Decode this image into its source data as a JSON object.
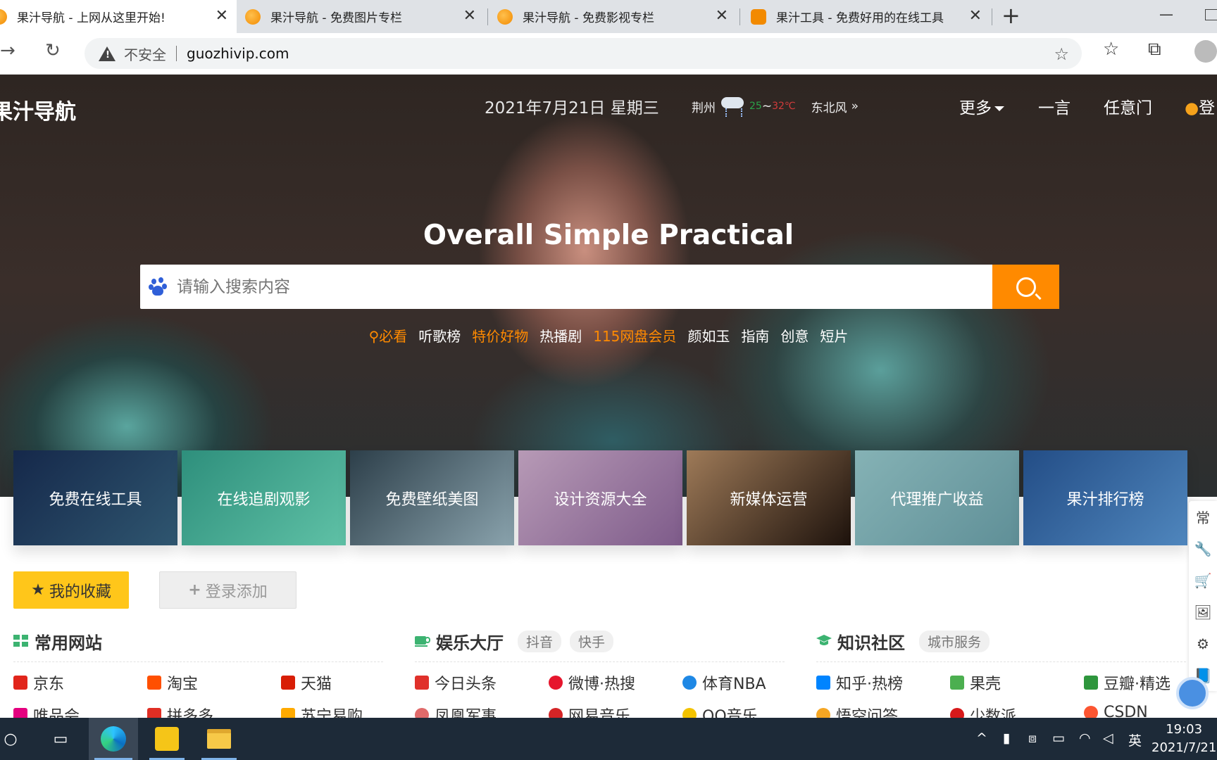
{
  "browser": {
    "tabs": [
      {
        "title": "果汁导航 - 上网从这里开始!",
        "active": true
      },
      {
        "title": "果汁导航 - 免费图片专栏",
        "active": false
      },
      {
        "title": "果汁导航 - 免费影视专栏",
        "active": false
      },
      {
        "title": "果汁工具 - 免费好用的在线工具",
        "active": false
      }
    ],
    "close_glyph": "✕",
    "new_tab_glyph": "+",
    "security_label": "不安全",
    "url": "guozhivip.com"
  },
  "header": {
    "brand": "果汁导航",
    "date": "2021年7月21日 星期三",
    "weather": {
      "city": "荆州",
      "low": "25",
      "sep": "~",
      "high": "32℃",
      "wind": "东北风",
      "more": "»"
    },
    "nav": {
      "more": "更多",
      "yiyan": "一言",
      "renyimen": "任意门",
      "login": "登"
    }
  },
  "hero": {
    "title": "Overall Simple Practical",
    "search_placeholder": "请输入搜索内容",
    "hot": [
      {
        "text": "必看",
        "highlight": true,
        "icon": "pin-icon"
      },
      {
        "text": "听歌榜",
        "highlight": false
      },
      {
        "text": "特价好物",
        "highlight": true
      },
      {
        "text": "热播剧",
        "highlight": false
      },
      {
        "text": "115网盘会员",
        "highlight": true
      },
      {
        "text": "颜如玉",
        "highlight": false
      },
      {
        "text": "指南",
        "highlight": false
      },
      {
        "text": "创意",
        "highlight": false
      },
      {
        "text": "短片",
        "highlight": false
      }
    ]
  },
  "cards": [
    {
      "label": "免费在线工具",
      "color": "#1f3b5e"
    },
    {
      "label": "在线追剧观影",
      "color": "#3fa58e"
    },
    {
      "label": "免费壁纸美图",
      "color": "#3f5560"
    },
    {
      "label": "设计资源大全",
      "color": "#8f6f95"
    },
    {
      "label": "新媒体运营",
      "color": "#6a4428"
    },
    {
      "label": "代理推广收益",
      "color": "#6c9fa8"
    },
    {
      "label": "果汁排行榜",
      "color": "#2d5c92"
    }
  ],
  "side_float": [
    "常",
    "🔧",
    "🛒",
    "🖼",
    "⚙",
    "📘"
  ],
  "favorites": {
    "my": "我的收藏",
    "add": "登录添加"
  },
  "sections": [
    {
      "title": "常用网站",
      "icon_color": "#3cb371",
      "chips": [],
      "links": [
        {
          "text": "京东",
          "color": "#e1251b"
        },
        {
          "text": "淘宝",
          "color": "#ff5000"
        },
        {
          "text": "天猫",
          "color": "#d81e06"
        },
        {
          "text": "唯品会",
          "color": "#e4007f"
        },
        {
          "text": "拼多多",
          "color": "#e02e24"
        },
        {
          "text": "苏宁易购",
          "color": "#ffaa00"
        }
      ]
    },
    {
      "title": "娱乐大厅",
      "icon_color": "#3cb371",
      "chips": [
        "抖音",
        "快手"
      ],
      "links": [
        {
          "text": "今日头条",
          "color": "#e0312b"
        },
        {
          "text": "微博·热搜",
          "color": "#e6162d"
        },
        {
          "text": "体育NBA",
          "color": "#1e88e5"
        },
        {
          "text": "凤凰军事",
          "color": "#e06a6a"
        },
        {
          "text": "网易音乐",
          "color": "#d42426"
        },
        {
          "text": "QQ音乐",
          "color": "#f3c300"
        }
      ]
    },
    {
      "title": "知识社区",
      "icon_color": "#3cb371",
      "chips": [
        "城市服务"
      ],
      "links": [
        {
          "text": "知乎·热榜",
          "color": "#0084ff"
        },
        {
          "text": "果壳",
          "color": "#4caf50"
        },
        {
          "text": "豆瓣·精选",
          "color": "#2e963d"
        },
        {
          "text": "悟空问答",
          "color": "#f5a623"
        },
        {
          "text": "少数派",
          "color": "#d7191a"
        },
        {
          "text": "CSDN",
          "color": "#fc5531"
        }
      ]
    }
  ],
  "taskbar": {
    "ime": "英",
    "time": "19:03",
    "date": "2021/7/21"
  }
}
